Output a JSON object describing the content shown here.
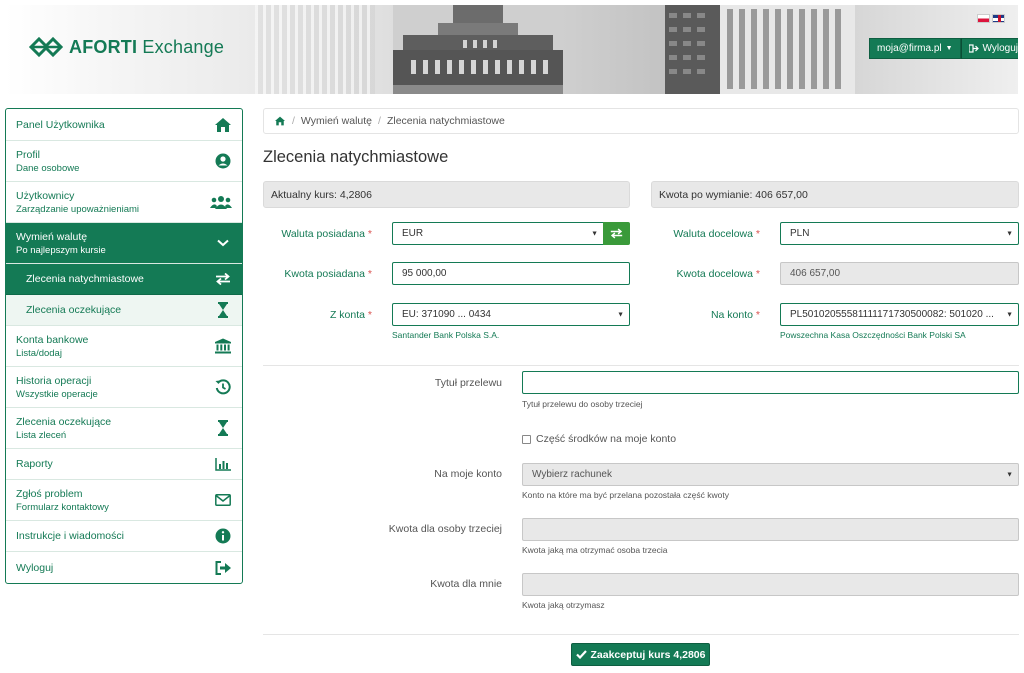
{
  "app": {
    "logo_name": "AFORTI",
    "logo_suffix": "Exchange",
    "user_email": "moja@firma.pl",
    "logout_label": "Wyloguj",
    "brand_color": "#147a55"
  },
  "sidebar": {
    "items": [
      {
        "title": "Panel Użytkownika",
        "subtitle": "",
        "icon": "home-icon"
      },
      {
        "title": "Profil",
        "subtitle": "Dane osobowe",
        "icon": "user-circle-icon"
      },
      {
        "title": "Użytkownicy",
        "subtitle": "Zarządzanie upoważnieniami",
        "icon": "users-icon"
      },
      {
        "title": "Wymień walutę",
        "subtitle": "Po najlepszym kursie",
        "icon": "chevron-down-icon"
      },
      {
        "title": "Zlecenia natychmiastowe",
        "subtitle": "",
        "icon": "exchange-icon"
      },
      {
        "title": "Zlecenia oczekujące",
        "subtitle": "",
        "icon": "hourglass-icon"
      },
      {
        "title": "Konta bankowe",
        "subtitle": "Lista/dodaj",
        "icon": "bank-icon"
      },
      {
        "title": "Historia operacji",
        "subtitle": "Wszystkie operacje",
        "icon": "history-icon"
      },
      {
        "title": "Zlecenia oczekujące",
        "subtitle": "Lista zleceń",
        "icon": "hourglass-icon"
      },
      {
        "title": "Raporty",
        "subtitle": "",
        "icon": "bar-chart-icon"
      },
      {
        "title": "Zgłoś problem",
        "subtitle": "Formularz kontaktowy",
        "icon": "envelope-icon"
      },
      {
        "title": "Instrukcje i wiadomości",
        "subtitle": "",
        "icon": "info-icon"
      },
      {
        "title": "Wyloguj",
        "subtitle": "",
        "icon": "sign-out-icon"
      }
    ]
  },
  "breadcrumb": {
    "items": [
      "Wymień walutę",
      "Zlecenia natychmiastowe"
    ]
  },
  "page": {
    "title": "Zlecenia natychmiastowe",
    "rate_info": "Aktualny kurs: 4,2806",
    "amount_info": "Kwota po wymianie: 406 657,00"
  },
  "form": {
    "source_currency_label": "Waluta posiadana",
    "source_currency_value": "EUR",
    "target_currency_label": "Waluta docelowa",
    "target_currency_value": "PLN",
    "source_amount_label": "Kwota posiadana",
    "source_amount_value": "95 000,00",
    "target_amount_label": "Kwota docelowa",
    "target_amount_value": "406 657,00",
    "from_account_label": "Z konta",
    "from_account_value": "EU: 371090 ... 0434",
    "from_account_bank": "Santander Bank Polska S.A.",
    "to_account_label": "Na konto",
    "to_account_value": "PL50102055581111171730500082: 501020 ...",
    "to_account_bank": "Powszechna Kasa Oszczędności Bank Polski SA",
    "transfer_title_label": "Tytuł przelewu",
    "transfer_title_value": "",
    "transfer_title_help": "Tytuł przelewu do osoby trzeciej",
    "own_account_checkbox": "Część środków na moje konto",
    "own_account_label": "Na moje konto",
    "own_account_placeholder": "Wybierz rachunek",
    "own_account_help": "Konto na które ma być przelana pozostała część kwoty",
    "third_party_amount_label": "Kwota dla osoby trzeciej",
    "third_party_amount_help": "Kwota jaką ma otrzymać osoba trzecia",
    "my_amount_label": "Kwota dla mnie",
    "my_amount_help": "Kwota jaką otrzymasz",
    "required_mark": "*",
    "accept_label": "Zaakceptuj kurs 4,2806"
  }
}
